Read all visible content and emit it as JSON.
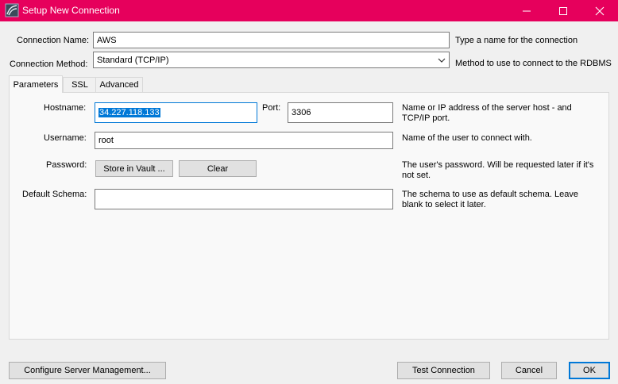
{
  "window": {
    "title": "Setup New Connection",
    "accent": "#e6005c"
  },
  "connection_name": {
    "label": "Connection Name:",
    "value": "AWS",
    "hint": "Type a name for the connection"
  },
  "connection_method": {
    "label": "Connection Method:",
    "value": "Standard (TCP/IP)",
    "hint": "Method to use to connect to the RDBMS"
  },
  "tabs": [
    {
      "label": "Parameters",
      "active": true
    },
    {
      "label": "SSL",
      "active": false
    },
    {
      "label": "Advanced",
      "active": false
    }
  ],
  "parameters": {
    "hostname": {
      "label": "Hostname:",
      "value": "34.227.118.133",
      "hint": "Name or IP address of the server host - and TCP/IP port."
    },
    "port": {
      "label": "Port:",
      "value": "3306"
    },
    "username": {
      "label": "Username:",
      "value": "root",
      "hint": "Name of the user to connect with."
    },
    "password": {
      "label": "Password:",
      "store_button": "Store in Vault ...",
      "clear_button": "Clear",
      "hint": "The user's password. Will be requested later if it's not set."
    },
    "default_schema": {
      "label": "Default Schema:",
      "value": "",
      "hint": "The schema to use as default schema. Leave blank to select it later."
    }
  },
  "footer": {
    "configure_button": "Configure Server Management...",
    "test_button": "Test Connection",
    "cancel_button": "Cancel",
    "ok_button": "OK"
  }
}
